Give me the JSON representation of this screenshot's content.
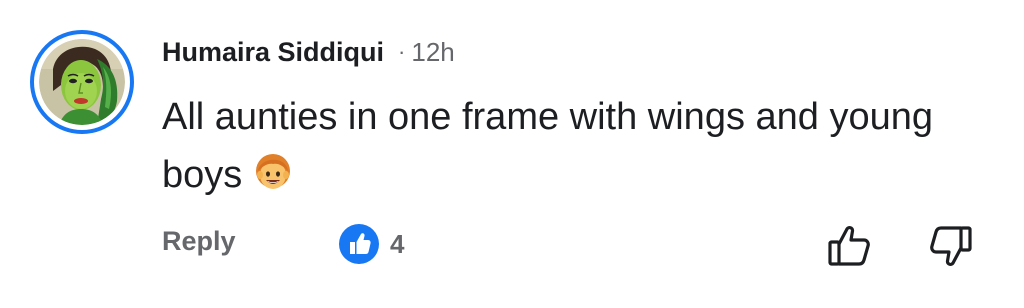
{
  "comment": {
    "author": "Humaira Siddiqui",
    "separator": "·",
    "time": "12h",
    "text": "All aunties in one frame with wings and young boys",
    "emoji": "boy-emoji",
    "actions": {
      "reply_label": "Reply",
      "reaction_icon": "like-reaction-icon",
      "reaction_count": "4",
      "like_icon": "thumbs-up-icon",
      "dislike_icon": "thumbs-down-icon"
    }
  },
  "colors": {
    "accent": "#1877f2",
    "secondary_text": "#65676b",
    "primary_text": "#1c1e21"
  }
}
